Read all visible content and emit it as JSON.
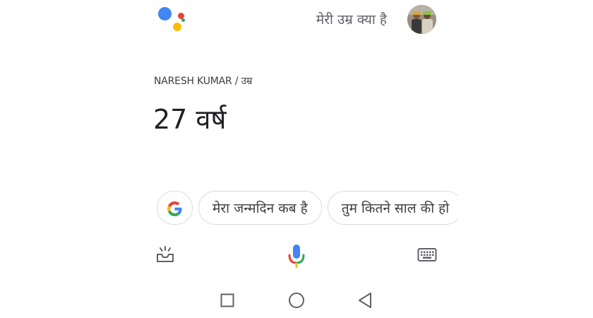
{
  "header": {
    "query_text": "मेरी उम्र क्या है",
    "logo": "google-assistant-logo",
    "avatar": "user-avatar"
  },
  "answer": {
    "subtitle": "NARESH KUMAR / उम्र",
    "value": "27 वर्ष"
  },
  "suggestions": {
    "google_icon": "google-g-icon",
    "chips": [
      "मेरा जन्मदिन कब है",
      "तुम कितने साल की हो"
    ]
  },
  "bottom_bar": {
    "left_icon": "explore-inbox-icon",
    "center_icon": "microphone-icon",
    "right_icon": "keyboard-icon"
  },
  "system_nav": {
    "icons": [
      "recent-apps-square-icon",
      "home-circle-icon",
      "back-triangle-icon"
    ]
  },
  "colors": {
    "google_blue": "#4285f4",
    "google_red": "#ea4335",
    "google_yellow": "#fbbc05",
    "google_green": "#34a853",
    "chip_border": "#dadce0",
    "icon_grey": "#5f6368"
  }
}
